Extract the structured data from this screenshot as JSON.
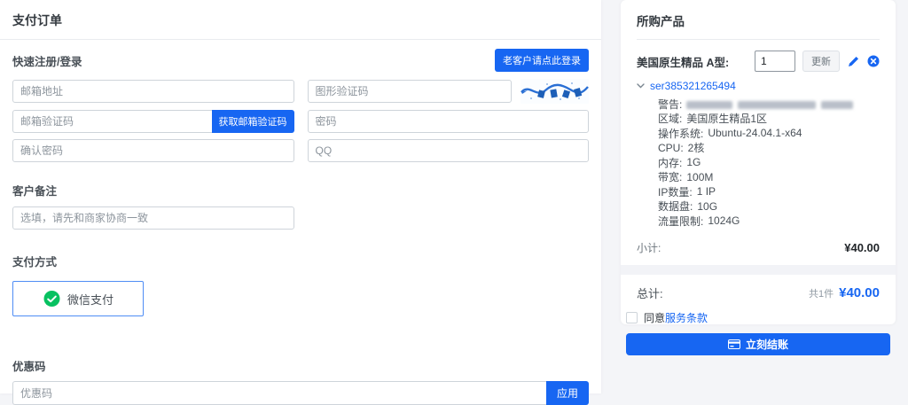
{
  "accent_color": "#1766f2",
  "wechat_green": "#07c160",
  "left": {
    "title": "支付订单",
    "register": {
      "heading": "快速注册/登录",
      "login_button": "老客户请点此登录",
      "email_placeholder": "邮箱地址",
      "captcha_placeholder": "图形验证码",
      "email_code_placeholder": "邮箱验证码",
      "get_code_button": "获取邮箱验证码",
      "password_placeholder": "密码",
      "confirm_password_placeholder": "确认密码",
      "qq_placeholder": "QQ"
    },
    "notes": {
      "heading": "客户备注",
      "placeholder": "选填，请先和商家协商一致"
    },
    "payment": {
      "heading": "支付方式",
      "wechat_label": "微信支付"
    },
    "coupon": {
      "heading": "优惠码",
      "placeholder": "优惠码",
      "apply_button": "应用"
    }
  },
  "right": {
    "title": "所购产品",
    "product": {
      "name": "美国原生精品 A型:",
      "quantity": "1",
      "update_button": "更新",
      "service_id": "ser385321265494",
      "details": [
        {
          "label": "警告:",
          "value": ""
        },
        {
          "label": "区域:",
          "value": "美国原生精品1区"
        },
        {
          "label": "操作系统:",
          "value": "Ubuntu-24.04.1-x64"
        },
        {
          "label": "CPU:",
          "value": "2核"
        },
        {
          "label": "内存:",
          "value": "1G"
        },
        {
          "label": "带宽:",
          "value": "100M"
        },
        {
          "label": "IP数量:",
          "value": "1 IP"
        },
        {
          "label": "数据盘:",
          "value": "10G"
        },
        {
          "label": "流量限制:",
          "value": "1024G"
        }
      ]
    },
    "summary": {
      "subtotal_label": "小计:",
      "subtotal_value": "¥40.00",
      "total_label": "总计:",
      "total_count": "共1件",
      "total_value": "¥40.00",
      "terms_agree": "同意",
      "terms_link": "服务条款",
      "checkout_button": "立刻结账"
    }
  }
}
